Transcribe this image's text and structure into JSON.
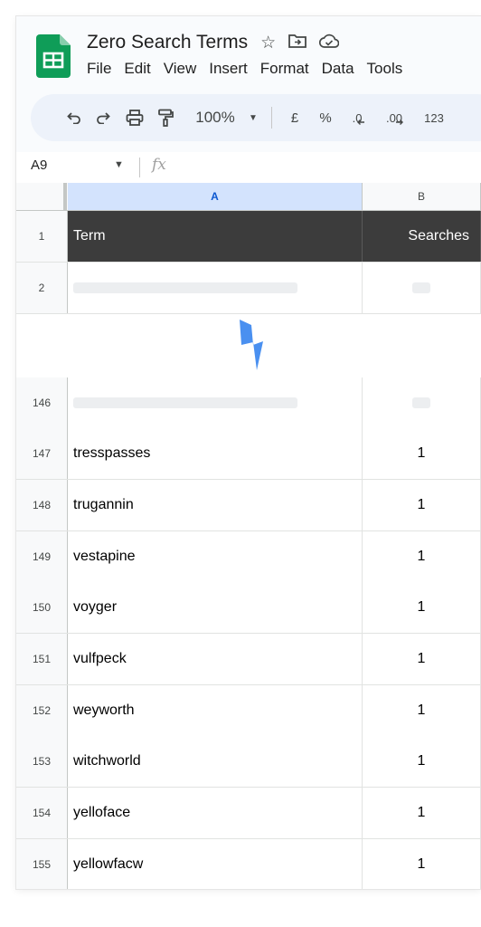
{
  "doc": {
    "title": "Zero Search Terms",
    "star_icon": "star-icon",
    "move_icon": "folder-move-icon",
    "cloud_icon": "cloud-saved-icon"
  },
  "menu": [
    "File",
    "Edit",
    "View",
    "Insert",
    "Format",
    "Data",
    "Tools"
  ],
  "toolbar": {
    "zoom": "100%",
    "currency": "£",
    "percent": "%",
    "dec_decrease": ".0",
    "dec_increase": ".00",
    "format_number": "123"
  },
  "formula_bar": {
    "cell_ref": "A9",
    "fx_label": "fx"
  },
  "columns": [
    "A",
    "B"
  ],
  "header_row": {
    "num": "1",
    "a": "Term",
    "b": "Searches"
  },
  "skeleton_rows": [
    "2",
    "146"
  ],
  "rows": [
    {
      "num": "147",
      "term": "tresspasses",
      "searches": "1"
    },
    {
      "num": "148",
      "term": "trugannin",
      "searches": "1"
    },
    {
      "num": "149",
      "term": "vestapine",
      "searches": "1"
    },
    {
      "num": "150",
      "term": "voyger",
      "searches": "1"
    },
    {
      "num": "151",
      "term": "vulfpeck",
      "searches": "1"
    },
    {
      "num": "152",
      "term": "weyworth",
      "searches": "1"
    },
    {
      "num": "153",
      "term": "witchworld",
      "searches": "1"
    },
    {
      "num": "154",
      "term": "yelloface",
      "searches": "1"
    },
    {
      "num": "155",
      "term": "yellowfacw",
      "searches": "1"
    }
  ],
  "colors": {
    "accent": "#0b57d0",
    "sheets_green": "#0f9d58",
    "header_fill": "#3c3c3c",
    "bolt": "#4a90f0"
  }
}
